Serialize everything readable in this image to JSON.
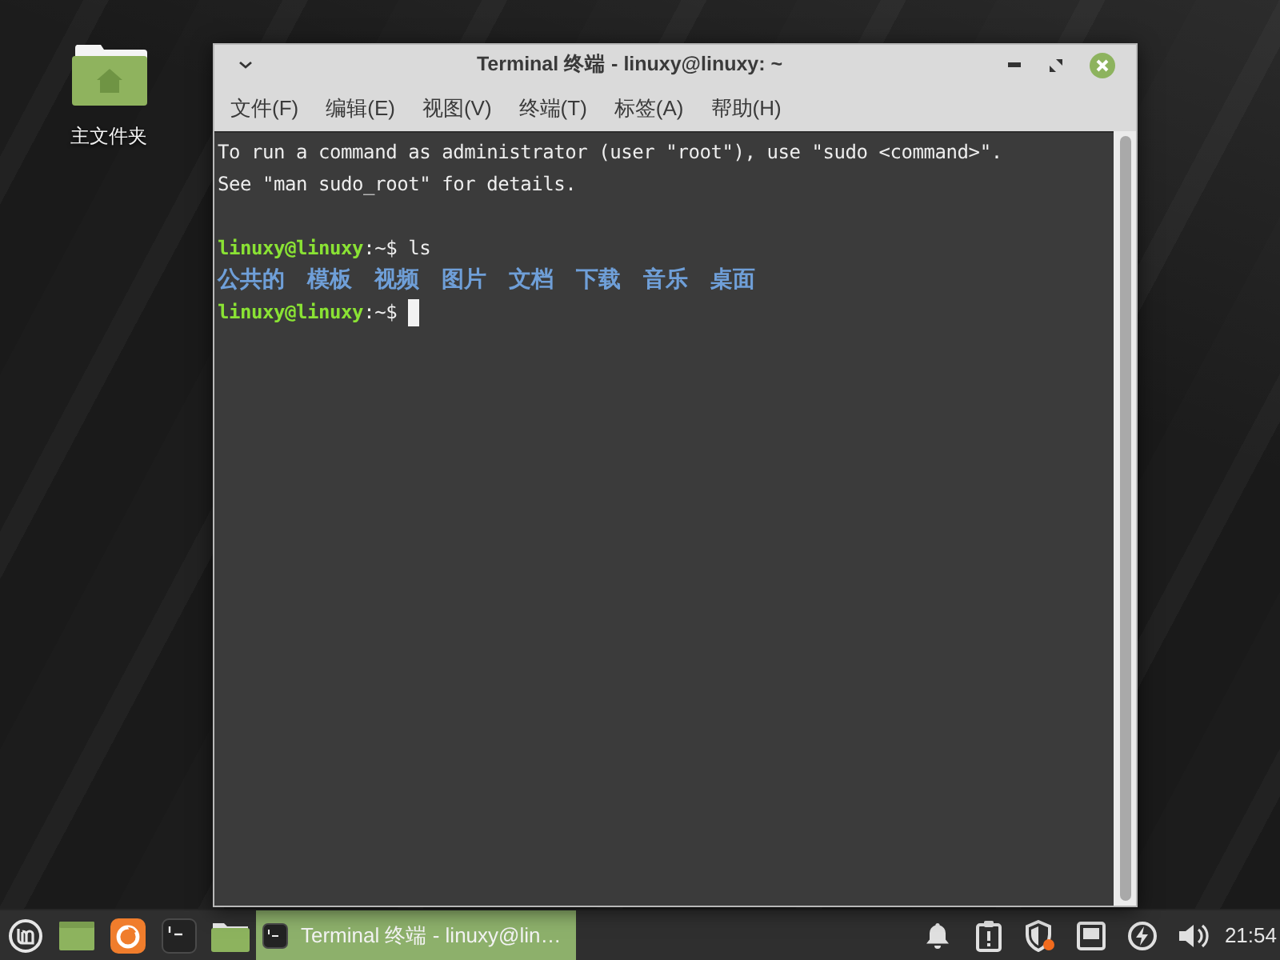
{
  "desktop": {
    "icons": [
      {
        "label": "主文件夹"
      }
    ]
  },
  "window": {
    "title": "Terminal 终端 - linuxy@linuxy: ~",
    "menu": [
      {
        "label": "文件(F)"
      },
      {
        "label": "编辑(E)"
      },
      {
        "label": "视图(V)"
      },
      {
        "label": "终端(T)"
      },
      {
        "label": "标签(A)"
      },
      {
        "label": "帮助(H)"
      }
    ],
    "terminal": {
      "lines": [
        {
          "kind": "output",
          "text": "To run a command as administrator (user \"root\"), use \"sudo <command>\"."
        },
        {
          "kind": "output",
          "text": "See \"man sudo_root\" for details."
        },
        {
          "kind": "blank"
        },
        {
          "kind": "prompt",
          "user": "linuxy@linuxy",
          "tail": ":~$ ls",
          "cursor": false
        },
        {
          "kind": "listing",
          "entries": [
            "公共的",
            "模板",
            "视频",
            "图片",
            "文档",
            "下载",
            "音乐",
            "桌面"
          ]
        },
        {
          "kind": "prompt",
          "user": "linuxy@linuxy",
          "tail": ":~$",
          "cursor": true
        }
      ]
    }
  },
  "taskbar": {
    "launchers": [
      {
        "kind": "menu"
      },
      {
        "kind": "show-desktop"
      },
      {
        "kind": "browser"
      },
      {
        "kind": "terminal"
      },
      {
        "kind": "files"
      }
    ],
    "tasks": [
      {
        "label": "Terminal 终端 - linuxy@lin…",
        "selected": true
      }
    ],
    "tray": [
      {
        "kind": "notifications"
      },
      {
        "kind": "clipboard"
      },
      {
        "kind": "shield"
      },
      {
        "kind": "display"
      },
      {
        "kind": "power"
      },
      {
        "kind": "volume"
      }
    ],
    "clock": "21:54"
  }
}
